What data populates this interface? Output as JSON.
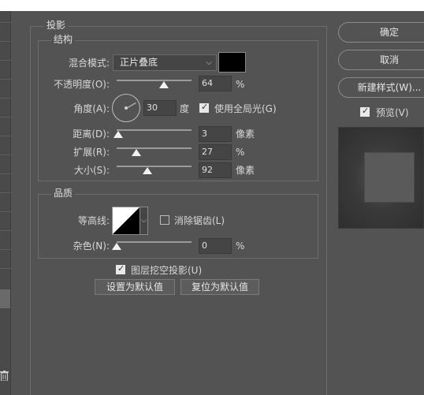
{
  "dialog": {
    "section_title": "投影",
    "structure": {
      "title": "结构",
      "blend_mode_label": "混合模式:",
      "blend_mode_value": "正片叠底",
      "blend_color": "#000000",
      "opacity_label": "不透明度(O):",
      "opacity_value": "64",
      "opacity_unit": "%",
      "opacity_fraction": 0.64,
      "angle_label": "角度(A):",
      "angle_value": "30",
      "angle_unit": "度",
      "global_light_label": "使用全局光(G)",
      "global_light_checked": true,
      "distance_label": "距离(D):",
      "distance_value": "3",
      "distance_unit": "像素",
      "spread_label": "扩展(R):",
      "spread_value": "27",
      "spread_unit": "%",
      "size_label": "大小(S):",
      "size_value": "92",
      "size_unit": "像素"
    },
    "quality": {
      "title": "品质",
      "contour_label": "等高线:",
      "anti_alias_label": "消除锯齿(L)",
      "anti_alias_checked": false,
      "noise_label": "杂色(N):",
      "noise_value": "0",
      "noise_unit": "%"
    },
    "knockout_label": "图层挖空投影(U)",
    "knockout_checked": true,
    "make_default_label": "设置为默认值",
    "reset_default_label": "复位为默认值"
  },
  "sidebar": {
    "ok_label": "确定",
    "cancel_label": "取消",
    "new_style_label": "新建样式(W)...",
    "preview_label": "预览(V)",
    "preview_checked": true
  }
}
